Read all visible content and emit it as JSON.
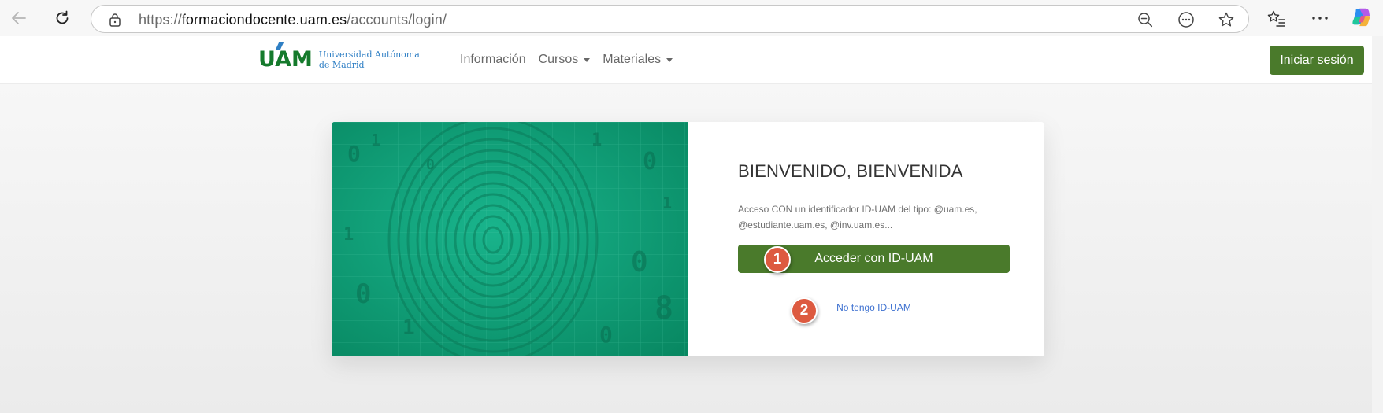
{
  "browser": {
    "url_prefix": "https://",
    "url_host": "formaciondocente.uam.es",
    "url_path": "/accounts/login/",
    "icons": [
      "back-arrow-icon",
      "refresh-icon",
      "lock-icon",
      "zoom-out-icon",
      "more-circle-icon",
      "favorite-star-icon",
      "favorites-list-icon",
      "ellipsis-icon",
      "copilot-icon"
    ]
  },
  "site": {
    "logo_mark": "UAM",
    "logo_line1": "Universidad Autónoma",
    "logo_line2": "de Madrid",
    "nav": [
      {
        "label": "Información"
      },
      {
        "label": "Cursos"
      },
      {
        "label": "Materiales"
      }
    ],
    "login_label": "Iniciar sesión",
    "accent_color": "#4a7a2b"
  },
  "card": {
    "title": "BIENVENIDO, BIENVENIDA",
    "description": "Acceso CON un identificador ID-UAM del tipo: @uam.es, @estudiante.uam.es, @inv.uam.es...",
    "primary_label": "Acceder con ID-UAM",
    "secondary_link": "No tengo ID-UAM"
  },
  "markers": [
    {
      "label": "1"
    },
    {
      "label": "2"
    }
  ]
}
